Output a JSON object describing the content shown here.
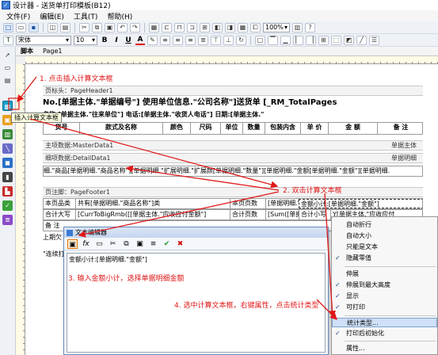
{
  "window": {
    "title": "设计器 - 送货单打印模板(B12)"
  },
  "menu": [
    "文件(F)",
    "编辑(E)",
    "工具(T)",
    "帮助(H)"
  ],
  "toolbar": {
    "font_name": "宋体",
    "font_size": "10",
    "zoom": "100%",
    "bold": "B",
    "italic": "I",
    "underline": "U",
    "font_color": "A"
  },
  "tabs": [
    "脚本",
    "Page1"
  ],
  "tooltip": "插入计算文本框",
  "report": {
    "page_header_band": "页标头：PageHeader1",
    "title_line": "No.[单据主体.\"单据编号\"] 使用单位信息.\"公司名称\"]送货单 [_RM_TotalPages",
    "info_line": "名称:[单据主体.\"往来单位\"]      电话:[单据主体.\"收货人电话\"] 日期:[单据主体.\"",
    "columns": [
      "货号",
      "款式及名称",
      "颜色",
      "尺码",
      "单位",
      "数量",
      "包装内含",
      "单 价",
      "金 额",
      "备 注"
    ],
    "master_band": "主项数据:MasterData1",
    "master_band_right": "单据主体",
    "detail_band": "细项数据:DetailData1",
    "detail_band_right": "单据明细",
    "detail_line": "细.\"商品[单据明细.\"商品名称\"][单据明细.\"扩展明细.\"扩展颜[单据明细.\"数量\"][单据明细.\"金额[单据明细.\"金额\"][单据明细.",
    "footer_band": "页注脚：PageFooter1",
    "footer_row1": {
      "label": "本页品类",
      "summary": "共有[单据明细.\"商品名称\"]类",
      "qty_label": "本页页数",
      "subtotal": "[单据明细.\"金额\"]",
      "money_label": "金额小计:"
    },
    "footer_row2": {
      "label": "合计大写",
      "cap": "[CurrToBigRmb([[单据主体.\"应收应付金额\"]",
      "qty_label": "合计页数",
      "sum": "[Sum([单据",
      "small": "合计小写",
      "total": "Y[单据主体.\"应收应付"
    },
    "remark_label": "备 注",
    "prev_note": "上期欠",
    "footnote": "\"连续打"
  },
  "editor_dialog": {
    "title": "文本编辑器",
    "content": "金额小计:[单据明细.\"金额\"]",
    "fx": "fx"
  },
  "context_menu": {
    "items": [
      {
        "label": "自动折行",
        "checked": false
      },
      {
        "label": "自动大小",
        "checked": false
      },
      {
        "label": "只能是文本",
        "checked": false
      },
      {
        "label": "隐藏零值",
        "checked": true
      },
      {
        "label": "伸展",
        "checked": false
      },
      {
        "label": "伸展到最大高度",
        "checked": true
      },
      {
        "label": "显示",
        "checked": true
      },
      {
        "label": "可打印",
        "checked": true
      },
      {
        "label": "统计类型...",
        "checked": false,
        "highlighted": true
      },
      {
        "label": "打印后初始化",
        "checked": true
      },
      {
        "label": "属性...",
        "checked": false
      }
    ]
  },
  "annotations": {
    "step1": "1. 点击插入计算文本框",
    "step2": "2. 双击计算文本框",
    "step3": "3. 输入金额小计，选择单据明细金额",
    "step4": "4. 选中计算文本框，右键属性，点击统计类型",
    "color": "#e01818"
  }
}
